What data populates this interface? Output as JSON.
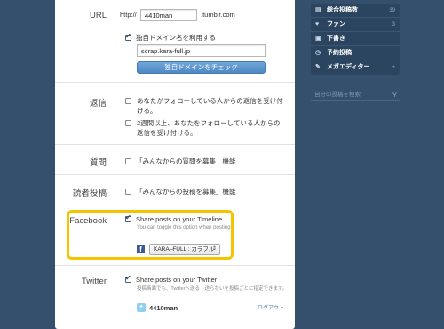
{
  "url_section": {
    "label": "URL",
    "prefix": "http://",
    "username": "4410man",
    "suffix": ".tumblr.com",
    "custom_domain_label": "独自ドメイン名を利用する",
    "custom_domain_value": "scrap.kara-full.jp",
    "check_button": "独自ドメインをチェック"
  },
  "reply_section": {
    "label": "返信",
    "option1": "あなたがフォローしている人からの返信を受け付ける。",
    "option2": "2週間以上、あなたをフォローしている人からの返信を受け付ける。"
  },
  "ask_section": {
    "label": "質問",
    "option": "「みんなからの質問を募集」機能"
  },
  "submit_section": {
    "label": "読者投稿",
    "option": "「みんなからの投稿を募集」機能"
  },
  "facebook_section": {
    "label": "Facebook",
    "option": "Share posts on your Timeline",
    "hint": "You can toggle this option when posting.",
    "page_select": "KARA–FULL : カラフル"
  },
  "twitter_section": {
    "label": "Twitter",
    "option": "Share posts on your Twitter",
    "hint": "投稿画面でも、Twitterへ送る・送らないを投稿ごとに指定できます。",
    "account": "4410man",
    "logout": "ログアウト"
  },
  "sidebar": {
    "items": [
      {
        "label": "総合投稿数",
        "count": "39",
        "icon": "pages-icon"
      },
      {
        "label": "ファン",
        "count": "3",
        "icon": "heart-icon"
      },
      {
        "label": "下書き",
        "count": "",
        "icon": "draft-icon"
      },
      {
        "label": "予約投稿",
        "count": "",
        "icon": "clock-icon"
      },
      {
        "label": "メガエディター",
        "count": "+",
        "icon": "editor-icon"
      }
    ],
    "search_placeholder": "自分の投稿を検索"
  },
  "colors": {
    "background": "#34506c",
    "highlight": "#f5c400",
    "button": "#5b95cf"
  }
}
